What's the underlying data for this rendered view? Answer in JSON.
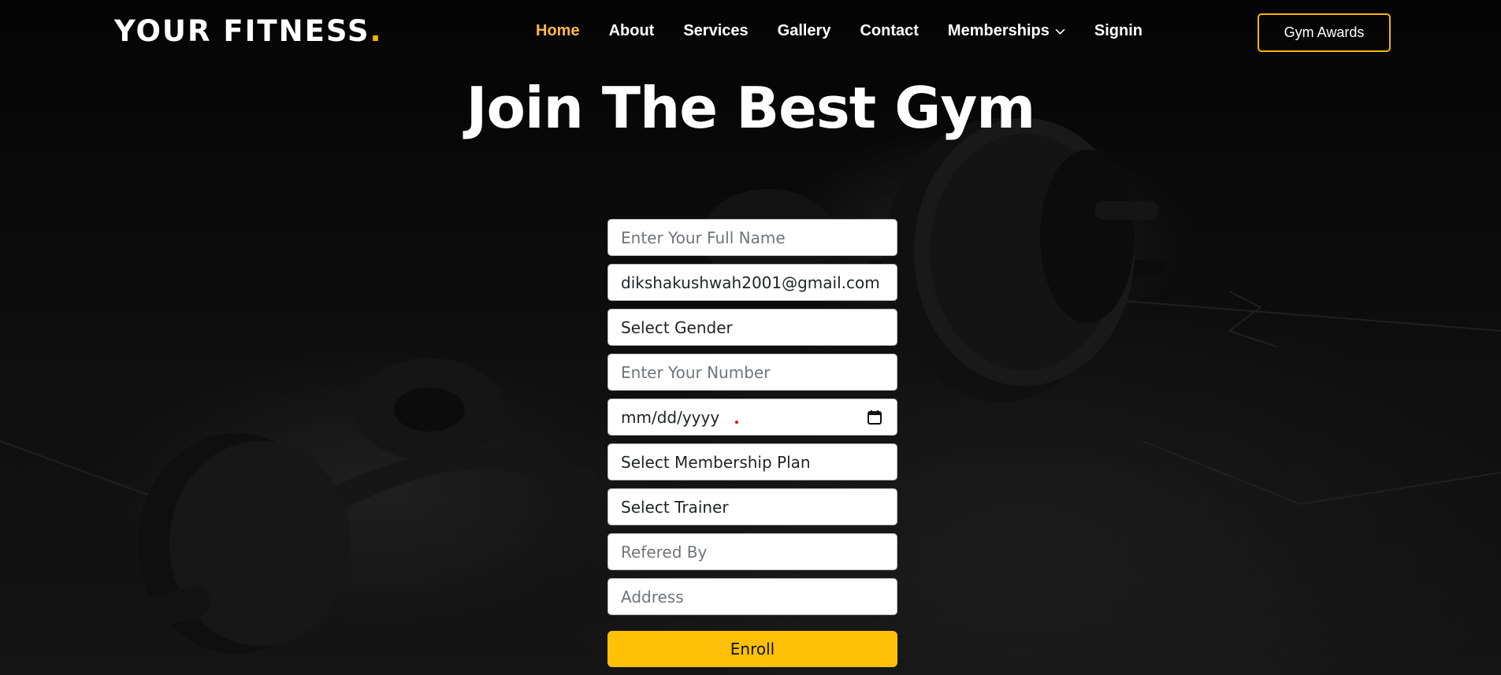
{
  "header": {
    "logo_text": "YOUR FITNESS",
    "logo_dot": ".",
    "nav": [
      {
        "label": "Home"
      },
      {
        "label": "About"
      },
      {
        "label": "Services"
      },
      {
        "label": "Gallery"
      },
      {
        "label": "Contact"
      },
      {
        "label": "Memberships"
      },
      {
        "label": "Signin"
      }
    ],
    "awards_button": "Gym Awards"
  },
  "hero": {
    "title": "Join The Best Gym"
  },
  "form": {
    "full_name": {
      "placeholder": "Enter Your Full Name",
      "value": ""
    },
    "email": {
      "value": "dikshakushwah2001@gmail.com"
    },
    "gender": {
      "selected": "Select Gender"
    },
    "number": {
      "placeholder": "Enter Your Number",
      "value": ""
    },
    "dob": {
      "display": "mm/dd/yyyy"
    },
    "membership": {
      "selected": "Select Membership Plan"
    },
    "trainer": {
      "selected": "Select Trainer"
    },
    "referred_by": {
      "placeholder": "Refered By",
      "value": ""
    },
    "address": {
      "placeholder": "Address",
      "value": ""
    },
    "submit_label": "Enroll"
  },
  "colors": {
    "accent": "#ffb400",
    "button": "#ffc107",
    "active_nav": "#ffb84d"
  }
}
